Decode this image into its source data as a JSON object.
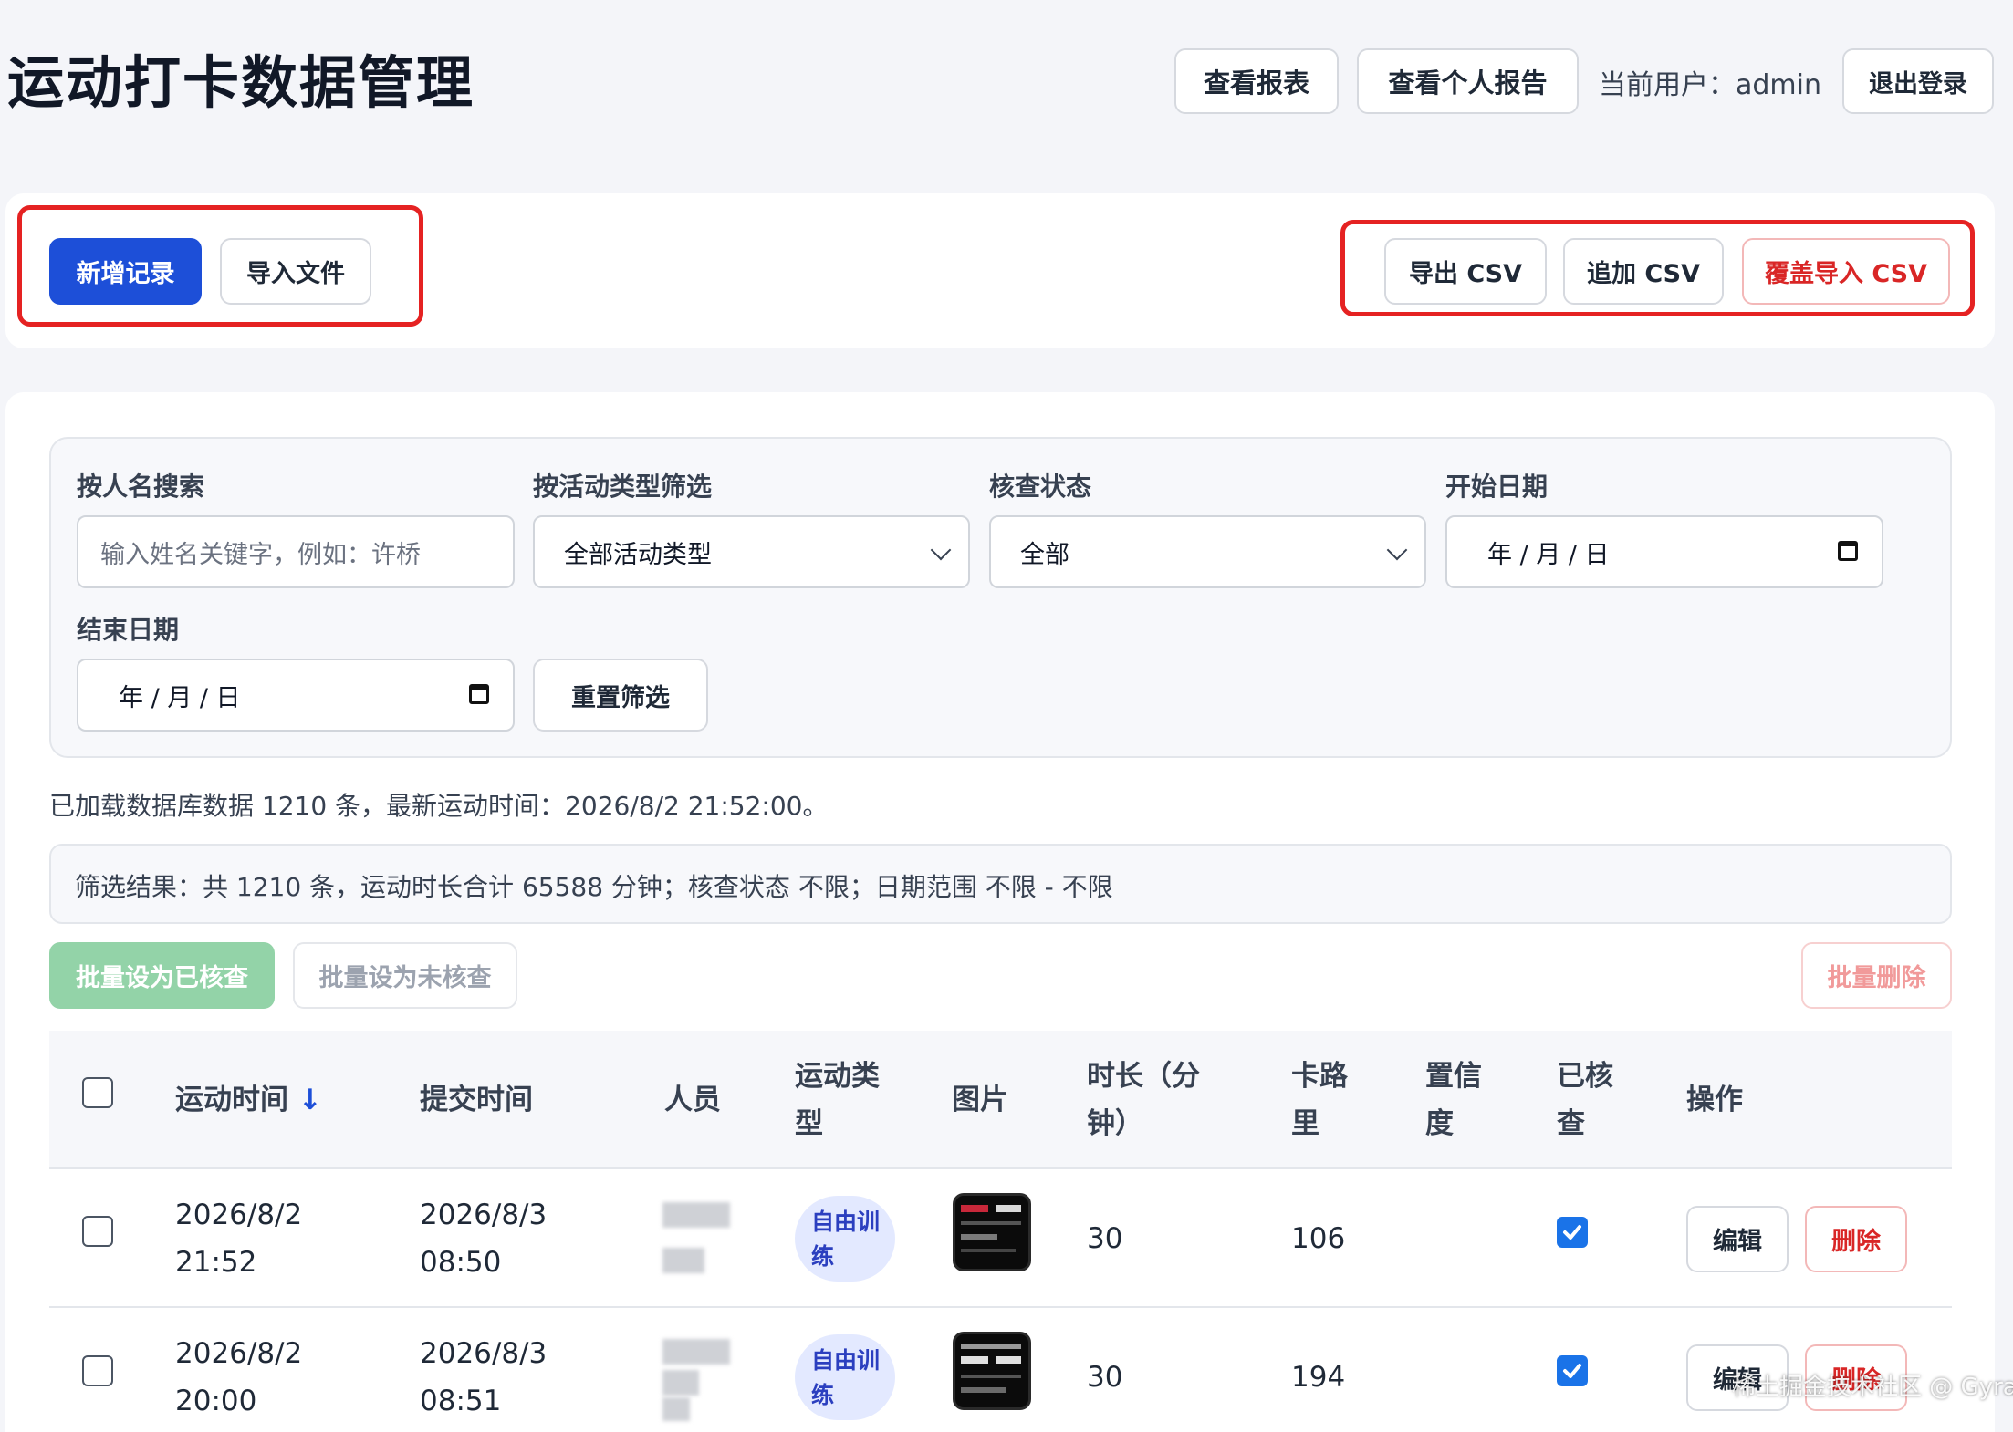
{
  "header": {
    "title": "运动打卡数据管理",
    "view_report": "查看报表",
    "view_personal_report": "查看个人报告",
    "current_user_label": "当前用户：",
    "current_user": "admin",
    "logout": "退出登录"
  },
  "actions": {
    "add_record": "新增记录",
    "import_file": "导入文件",
    "export_csv": "导出 CSV",
    "append_csv": "追加 CSV",
    "overwrite_csv": "覆盖导入 CSV"
  },
  "filters": {
    "name_label": "按人名搜索",
    "name_placeholder": "输入姓名关键字，例如：许桥",
    "type_label": "按活动类型筛选",
    "type_value": "全部活动类型",
    "status_label": "核查状态",
    "status_value": "全部",
    "start_label": "开始日期",
    "start_value": "年 / 月 / 日",
    "end_label": "结束日期",
    "end_value": "年 / 月 / 日",
    "reset": "重置筛选"
  },
  "info": {
    "loaded": "已加载数据库数据 1210 条，最新运动时间：2026/8/2 21:52:00。",
    "summary": "筛选结果：共 1210 条，运动时长合计 65588 分钟；核查状态 不限；日期范围 不限 - 不限"
  },
  "bulk": {
    "set_checked": "批量设为已核查",
    "set_unchecked": "批量设为未核查",
    "delete": "批量删除"
  },
  "table": {
    "headers": {
      "time": "运动时间",
      "sort_arrow": "↓",
      "submit": "提交时间",
      "person": "人员",
      "type_l1": "运动类",
      "type_l2": "型",
      "image": "图片",
      "dur_l1": "时长（分",
      "dur_l2": "钟）",
      "cal_l1": "卡路",
      "cal_l2": "里",
      "conf_l1": "置信",
      "conf_l2": "度",
      "chk_l1": "已核",
      "chk_l2": "查",
      "ops": "操作"
    },
    "rows": [
      {
        "date": "2026/8/2",
        "time": "21:52",
        "sub_date": "2026/8/3",
        "sub_time": "08:50",
        "type_l1": "自由训",
        "type_l2": "练",
        "duration": "30",
        "calories": "106",
        "checked": true,
        "edit": "编辑",
        "delete": "删除"
      },
      {
        "date": "2026/8/2",
        "time": "20:00",
        "sub_date": "2026/8/3",
        "sub_time": "08:51",
        "type_l1": "自由训",
        "type_l2": "练",
        "duration": "30",
        "calories": "194",
        "checked": true,
        "edit": "编辑",
        "delete": "删除"
      }
    ]
  },
  "watermark": "稀土掘金技术社区 @ Gyrate",
  "colors": {
    "primary": "#1d4fd8",
    "danger": "#d92626",
    "success_disabled": "#93d3a8",
    "highlight_frame": "#e52222",
    "pill_bg": "#e3e9ff"
  }
}
